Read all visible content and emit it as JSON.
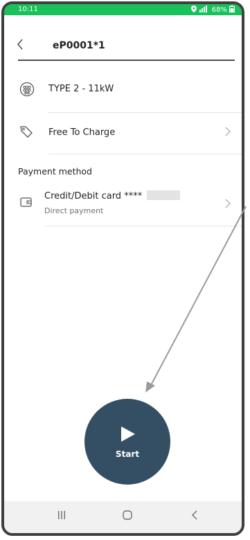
{
  "status_bar": {
    "time": "10:11",
    "battery": "68%"
  },
  "header": {
    "title": "eP0001*1"
  },
  "connector": {
    "label": "TYPE 2 - 11kW"
  },
  "pricing": {
    "label": "Free To Charge"
  },
  "payment": {
    "section_label": "Payment method",
    "card_label": "Credit/Debit card ****",
    "sub_label": "Direct payment"
  },
  "start_button": {
    "label": "Start"
  },
  "colors": {
    "status_bar": "#19c15a",
    "start_button": "#344f63",
    "annotation_arrow": "#9a9a9a"
  },
  "icons": {
    "back": "chevron-left-icon",
    "connector": "type2-connector-icon",
    "pricing": "price-tag-icon",
    "payment": "wallet-icon",
    "row_chevron": "chevron-right-icon",
    "start": "play-icon",
    "nav_recents": "recents-icon",
    "nav_home": "home-icon",
    "nav_back": "back-icon"
  }
}
